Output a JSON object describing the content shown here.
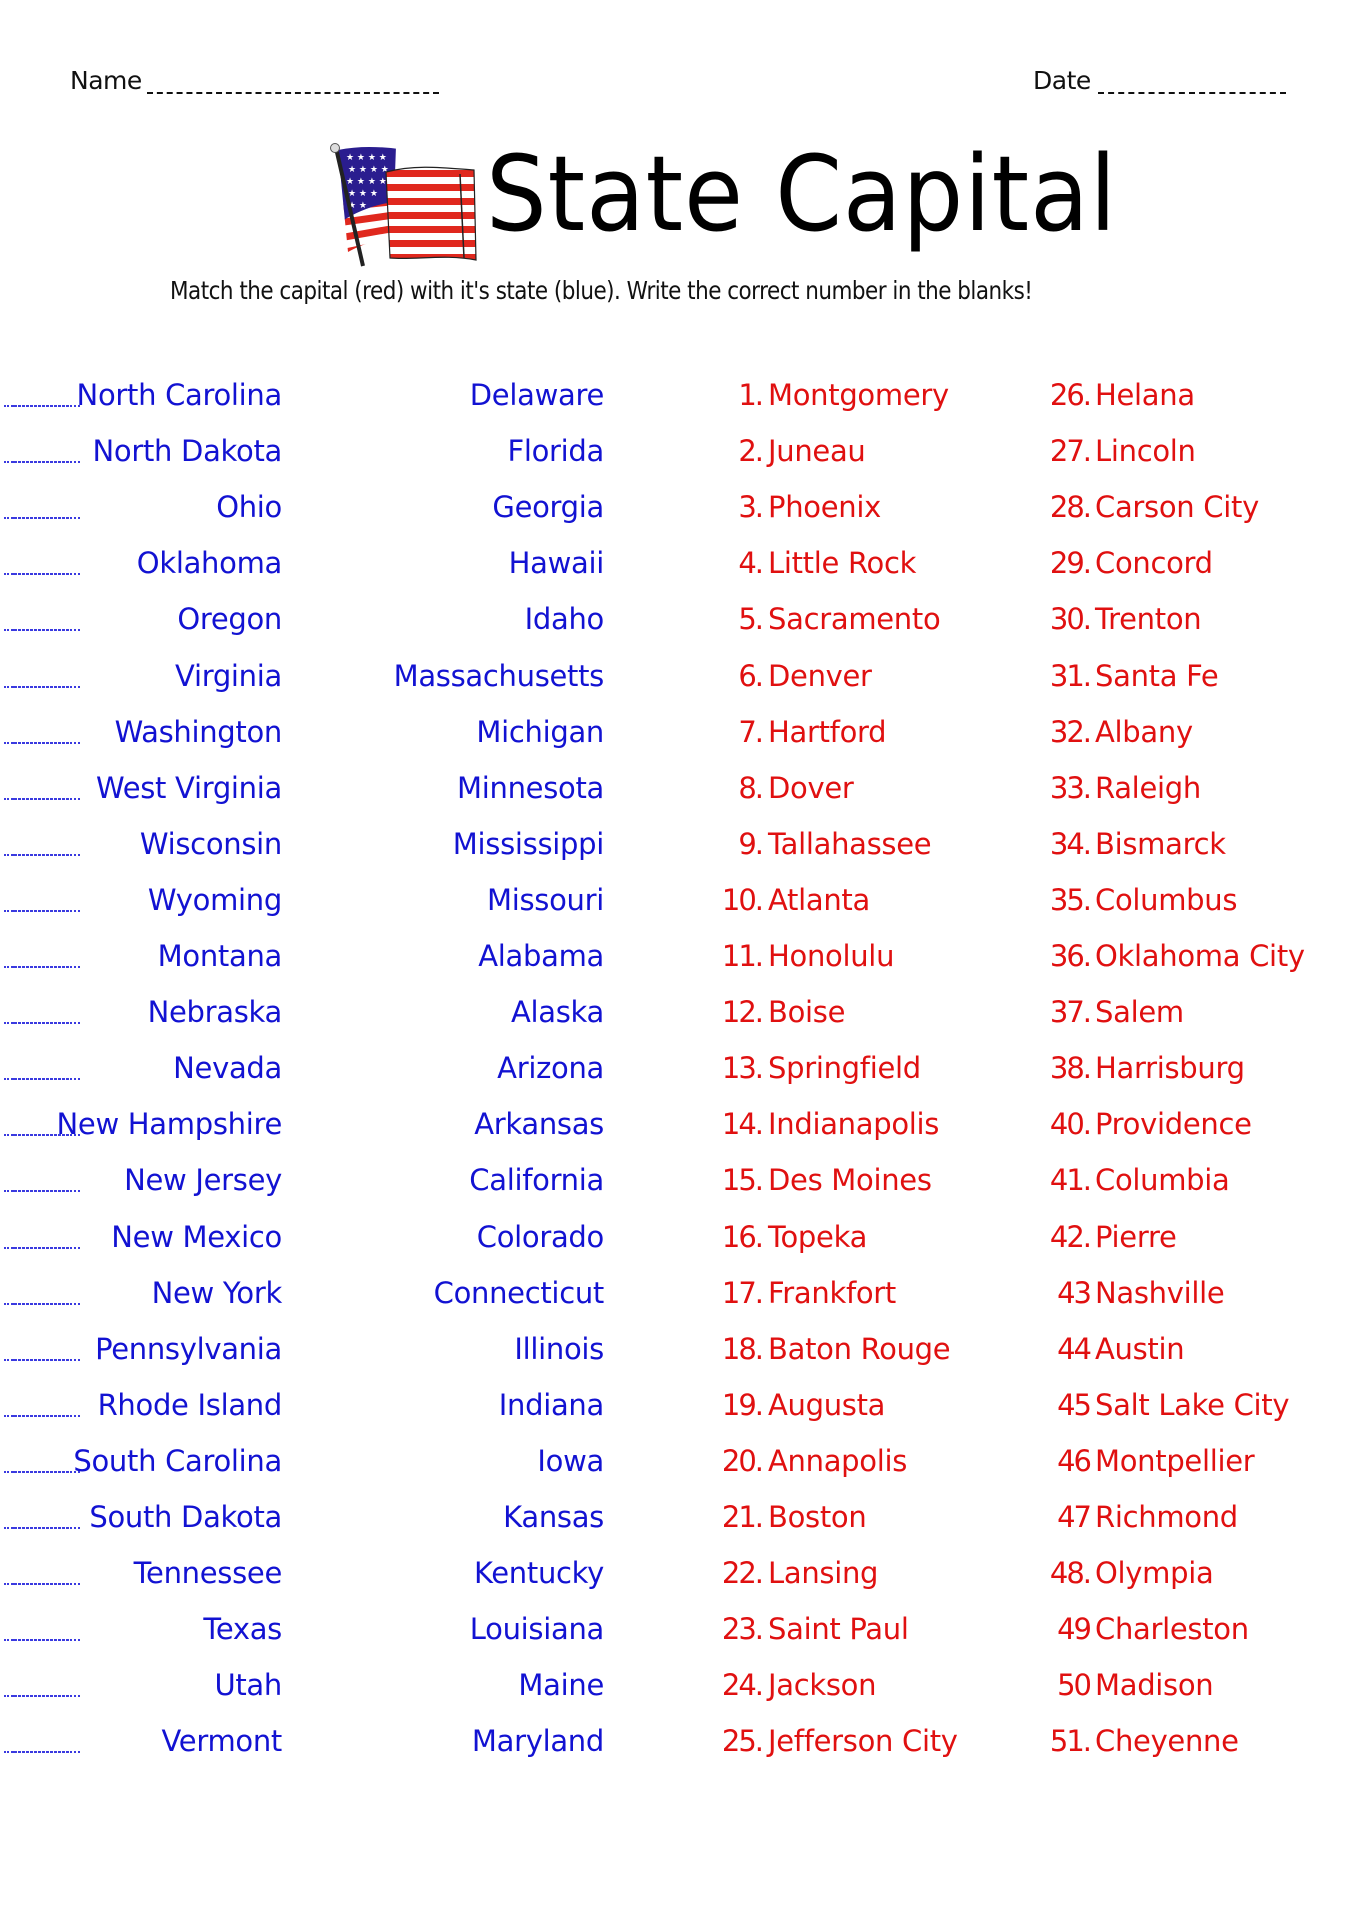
{
  "header": {
    "name_label": "Name",
    "date_label": "Date"
  },
  "title": "State Capital",
  "instructions": "Match the capital (red) with it's state (blue). Write the correct number in the blanks!",
  "colors": {
    "state_text": "#1212d2",
    "capital_text": "#e01010",
    "title_text": "#000000"
  },
  "flag_icon": "us-flag-icon",
  "states_column_1": [
    "North Carolina",
    "North Dakota",
    "Ohio",
    "Oklahoma",
    "Oregon",
    "Virginia",
    "Washington",
    "West Virginia",
    "Wisconsin",
    "Wyoming",
    "Montana",
    "Nebraska",
    "Nevada",
    "New Hampshire",
    "New Jersey",
    "New Mexico",
    "New York",
    "Pennsylvania",
    "Rhode Island",
    "South Carolina",
    "South Dakota",
    "Tennessee",
    "Texas",
    "Utah",
    "Vermont"
  ],
  "states_column_2": [
    "Delaware",
    "Florida",
    "Georgia",
    "Hawaii",
    "Idaho",
    "Massachusetts",
    "Michigan",
    "Minnesota",
    "Mississippi",
    "Missouri",
    "Alabama",
    "Alaska",
    "Arizona",
    "Arkansas",
    "California",
    "Colorado",
    "Connecticut",
    "Illinois",
    "Indiana",
    "Iowa",
    "Kansas",
    "Kentucky",
    "Louisiana",
    "Maine",
    "Maryland"
  ],
  "capitals_column_1": [
    {
      "num": "1.",
      "name": "Montgomery"
    },
    {
      "num": "2.",
      "name": "Juneau"
    },
    {
      "num": "3.",
      "name": "Phoenix"
    },
    {
      "num": "4.",
      "name": "Little Rock"
    },
    {
      "num": "5.",
      "name": "Sacramento"
    },
    {
      "num": "6.",
      "name": "Denver"
    },
    {
      "num": "7.",
      "name": "Hartford"
    },
    {
      "num": "8.",
      "name": "Dover"
    },
    {
      "num": "9.",
      "name": "Tallahassee"
    },
    {
      "num": "10.",
      "name": "Atlanta"
    },
    {
      "num": "11.",
      "name": "Honolulu"
    },
    {
      "num": "12.",
      "name": "Boise"
    },
    {
      "num": "13.",
      "name": "Springfield"
    },
    {
      "num": "14.",
      "name": "Indianapolis"
    },
    {
      "num": "15.",
      "name": "Des Moines"
    },
    {
      "num": "16.",
      "name": "Topeka"
    },
    {
      "num": "17.",
      "name": "Frankfort"
    },
    {
      "num": "18.",
      "name": "Baton Rouge"
    },
    {
      "num": "19.",
      "name": "Augusta"
    },
    {
      "num": "20.",
      "name": "Annapolis"
    },
    {
      "num": "21.",
      "name": "Boston"
    },
    {
      "num": "22.",
      "name": "Lansing"
    },
    {
      "num": "23.",
      "name": "Saint Paul"
    },
    {
      "num": "24.",
      "name": "Jackson"
    },
    {
      "num": "25.",
      "name": "Jefferson City"
    }
  ],
  "capitals_column_2": [
    {
      "num": "26.",
      "name": "Helana"
    },
    {
      "num": "27.",
      "name": "Lincoln"
    },
    {
      "num": "28.",
      "name": "Carson City"
    },
    {
      "num": "29.",
      "name": "Concord"
    },
    {
      "num": "30.",
      "name": "Trenton"
    },
    {
      "num": "31.",
      "name": "Santa Fe"
    },
    {
      "num": "32.",
      "name": "Albany"
    },
    {
      "num": "33.",
      "name": "Raleigh"
    },
    {
      "num": "34.",
      "name": "Bismarck"
    },
    {
      "num": "35.",
      "name": "Columbus"
    },
    {
      "num": "36.",
      "name": "Oklahoma City"
    },
    {
      "num": "37.",
      "name": "Salem"
    },
    {
      "num": "38.",
      "name": "Harrisburg"
    },
    {
      "num": "40.",
      "name": "Providence"
    },
    {
      "num": "41.",
      "name": "Columbia"
    },
    {
      "num": "42.",
      "name": "Pierre"
    },
    {
      "num": "43",
      "name": "Nashville"
    },
    {
      "num": "44",
      "name": "Austin"
    },
    {
      "num": "45",
      "name": "Salt Lake City"
    },
    {
      "num": "46",
      "name": "Montpellier"
    },
    {
      "num": "47",
      "name": "Richmond"
    },
    {
      "num": "48.",
      "name": "Olympia"
    },
    {
      "num": "49",
      "name": "Charleston"
    },
    {
      "num": "50",
      "name": "Madison"
    },
    {
      "num": "51.",
      "name": "Cheyenne"
    }
  ]
}
